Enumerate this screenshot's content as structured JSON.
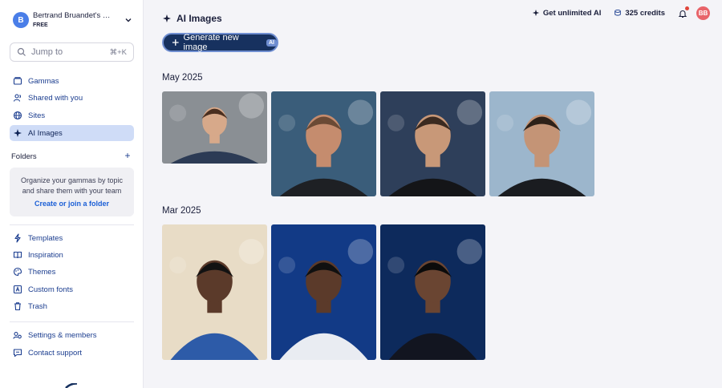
{
  "workspace": {
    "avatar_letter": "B",
    "name": "Bertrand Bruandet's Workspace",
    "plan": "FREE"
  },
  "search": {
    "placeholder": "Jump to",
    "shortcut": "⌘+K"
  },
  "nav_top": [
    {
      "label": "Gammas",
      "icon": "gammas-icon",
      "active": false
    },
    {
      "label": "Shared with you",
      "icon": "users-icon",
      "active": false
    },
    {
      "label": "Sites",
      "icon": "globe-icon",
      "active": false
    },
    {
      "label": "AI Images",
      "icon": "sparkle-icon",
      "active": true
    }
  ],
  "folders": {
    "label": "Folders",
    "hint": "Organize your gammas by topic and share them with your team",
    "link": "Create or join a folder"
  },
  "nav_bottom": [
    {
      "label": "Templates",
      "icon": "templates-icon"
    },
    {
      "label": "Inspiration",
      "icon": "book-icon"
    },
    {
      "label": "Themes",
      "icon": "palette-icon"
    },
    {
      "label": "Custom fonts",
      "icon": "font-icon"
    },
    {
      "label": "Trash",
      "icon": "trash-icon"
    }
  ],
  "nav_footer": [
    {
      "label": "Settings & members",
      "icon": "settings-icon"
    },
    {
      "label": "Contact support",
      "icon": "chat-icon"
    }
  ],
  "header": {
    "title": "AI Images",
    "unlimited": "Get unlimited AI",
    "credits": "325 credits",
    "user_initials": "BB"
  },
  "generate": {
    "label": "Generate new image",
    "badge": "AI"
  },
  "sections": [
    {
      "title": "May 2025",
      "images": [
        {
          "alt": "smiling man portrait",
          "palette": {
            "bg": "#8a8f94",
            "skin": "#d7a98a",
            "hair": "#4a2f20",
            "shirt": "#2c3b55"
          }
        },
        {
          "alt": "man with glasses portrait",
          "palette": {
            "bg": "#3a5d7a",
            "skin": "#c58c6e",
            "hair": "#6b4a35",
            "shirt": "#1e2024"
          }
        },
        {
          "alt": "man with glasses bokeh portrait",
          "palette": {
            "bg": "#2e3f5a",
            "skin": "#c89878",
            "hair": "#3b2a20",
            "shirt": "#141518"
          }
        },
        {
          "alt": "man with glasses light portrait",
          "palette": {
            "bg": "#9cb6cc",
            "skin": "#c49476",
            "hair": "#2e2118",
            "shirt": "#1a1c20"
          }
        }
      ]
    },
    {
      "title": "Mar 2025",
      "images": [
        {
          "alt": "pop art collage",
          "palette": {
            "bg": "#e8dcc6",
            "skin": "#5b3a2a",
            "hair": "#121212",
            "shirt": "#2d5ba8"
          }
        },
        {
          "alt": "dancer on stage",
          "palette": {
            "bg": "#123a86",
            "skin": "#5b3a2a",
            "hair": "#101010",
            "shirt": "#e9ecf2"
          }
        },
        {
          "alt": "performer in sequin jacket",
          "palette": {
            "bg": "#0d2a5c",
            "skin": "#6a4532",
            "hair": "#0b0b0b",
            "shirt": "#121520"
          }
        }
      ]
    }
  ],
  "colors": {
    "accent": "#17315f",
    "active_bg": "#cfdcf7",
    "link": "#1b5fd6",
    "notify": "#e0453b"
  }
}
